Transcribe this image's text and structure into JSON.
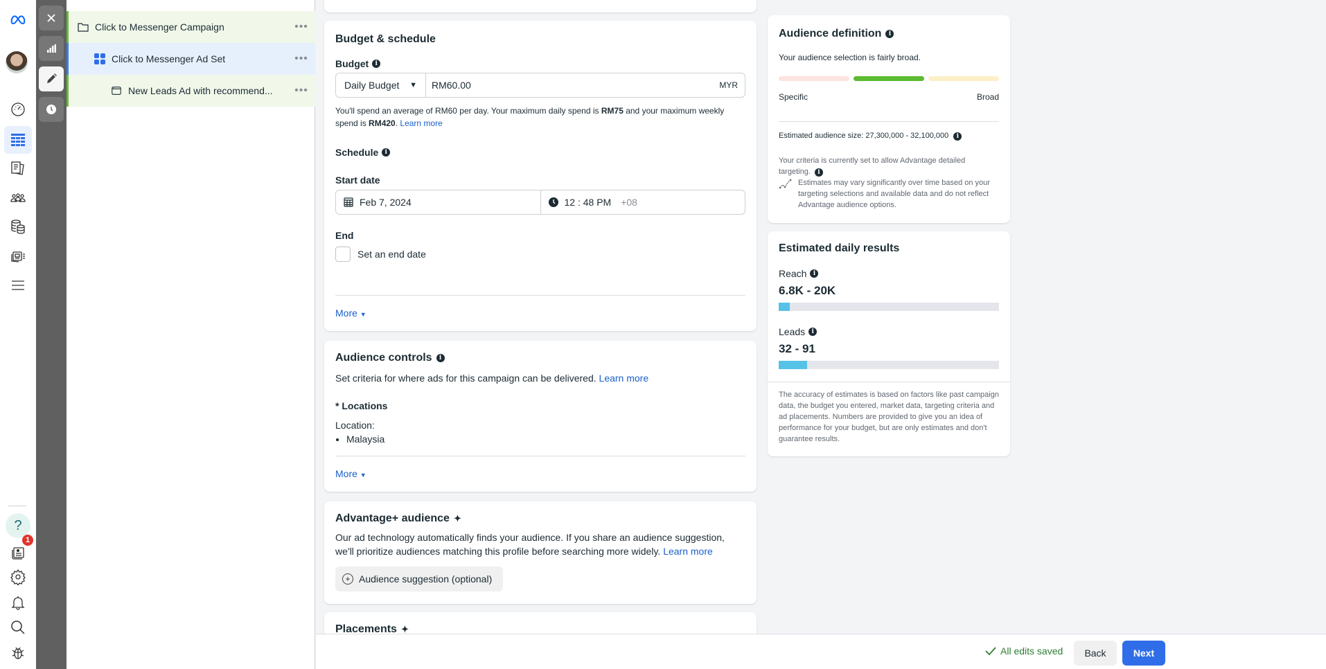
{
  "nav": {
    "items": [
      "meta-logo",
      "profile-avatar",
      "overview",
      "ads-manager",
      "pages",
      "audiences",
      "billing",
      "creative-hub",
      "all-tools"
    ],
    "bottom": [
      "help",
      "notifications-feed",
      "settings",
      "alerts",
      "search",
      "report-bug"
    ],
    "notification_count": "1",
    "help_glyph": "?"
  },
  "rail": {
    "buttons": [
      "close",
      "reports",
      "edit",
      "history"
    ]
  },
  "tree": {
    "campaign": "Click to Messenger Campaign",
    "adset": "Click to Messenger Ad Set",
    "ad": "New Leads Ad with recommend...",
    "more_glyph": "•••"
  },
  "budget": {
    "title": "Budget & schedule",
    "budget_label": "Budget",
    "budget_type": "Daily Budget",
    "amount": "RM60.00",
    "currency": "MYR",
    "spend_text_1": "You'll spend an average of RM60 per day. Your maximum daily spend is ",
    "max_daily": "RM75",
    "spend_text_2": " and your maximum weekly spend is ",
    "max_weekly": "RM420",
    "spend_text_3": ". ",
    "learn_more": "Learn more",
    "schedule_label": "Schedule",
    "start_date_label": "Start date",
    "start_date": "Feb 7, 2024",
    "start_time": "12 : 48 PM",
    "timezone": "+08",
    "end_label": "End",
    "end_checkbox_label": "Set an end date",
    "end_checked": false,
    "more": "More"
  },
  "audience_controls": {
    "title": "Audience controls",
    "desc": "Set criteria for where ads for this campaign can be delivered. ",
    "learn_more": "Learn more",
    "locations_label": "* Locations",
    "location_prefix": "Location:",
    "locations": [
      "Malaysia"
    ],
    "more": "More"
  },
  "advantage": {
    "title": "Advantage+ audience",
    "desc": "Our ad technology automatically finds your audience. If you share an audience suggestion, we'll prioritize audiences matching this profile before searching more widely. ",
    "learn_more": "Learn more",
    "suggestion_button": "Audience suggestion (optional)"
  },
  "placements": {
    "title": "Placements"
  },
  "audience_definition": {
    "title": "Audience definition",
    "summary": "Your audience selection is fairly broad.",
    "spectrum_colors": [
      "#fde3e1",
      "#5cbb30",
      "#fdf0c8"
    ],
    "spectrum_active_index": 1,
    "specific_label": "Specific",
    "broad_label": "Broad",
    "size_text": "Estimated audience size: 27,300,000 - 32,100,000",
    "criteria_text": "Your criteria is currently set to allow Advantage detailed targeting.",
    "vary_text": "Estimates may vary significantly over time based on your targeting selections and available data and do not reflect Advantage audience options."
  },
  "estimated_results": {
    "title": "Estimated daily results",
    "reach_label": "Reach",
    "reach_value": "6.8K - 20K",
    "reach_fill_pct": 5,
    "leads_label": "Leads",
    "leads_value": "32 - 91",
    "leads_fill_pct": 13,
    "disclaimer": "The accuracy of estimates is based on factors like past campaign data, the budget you entered, market data, targeting criteria and ad placements. Numbers are provided to give you an idea of performance for your budget, but are only estimates and don't guarantee results."
  },
  "footer": {
    "saved_status": "All edits saved",
    "back": "Back",
    "next": "Next"
  }
}
